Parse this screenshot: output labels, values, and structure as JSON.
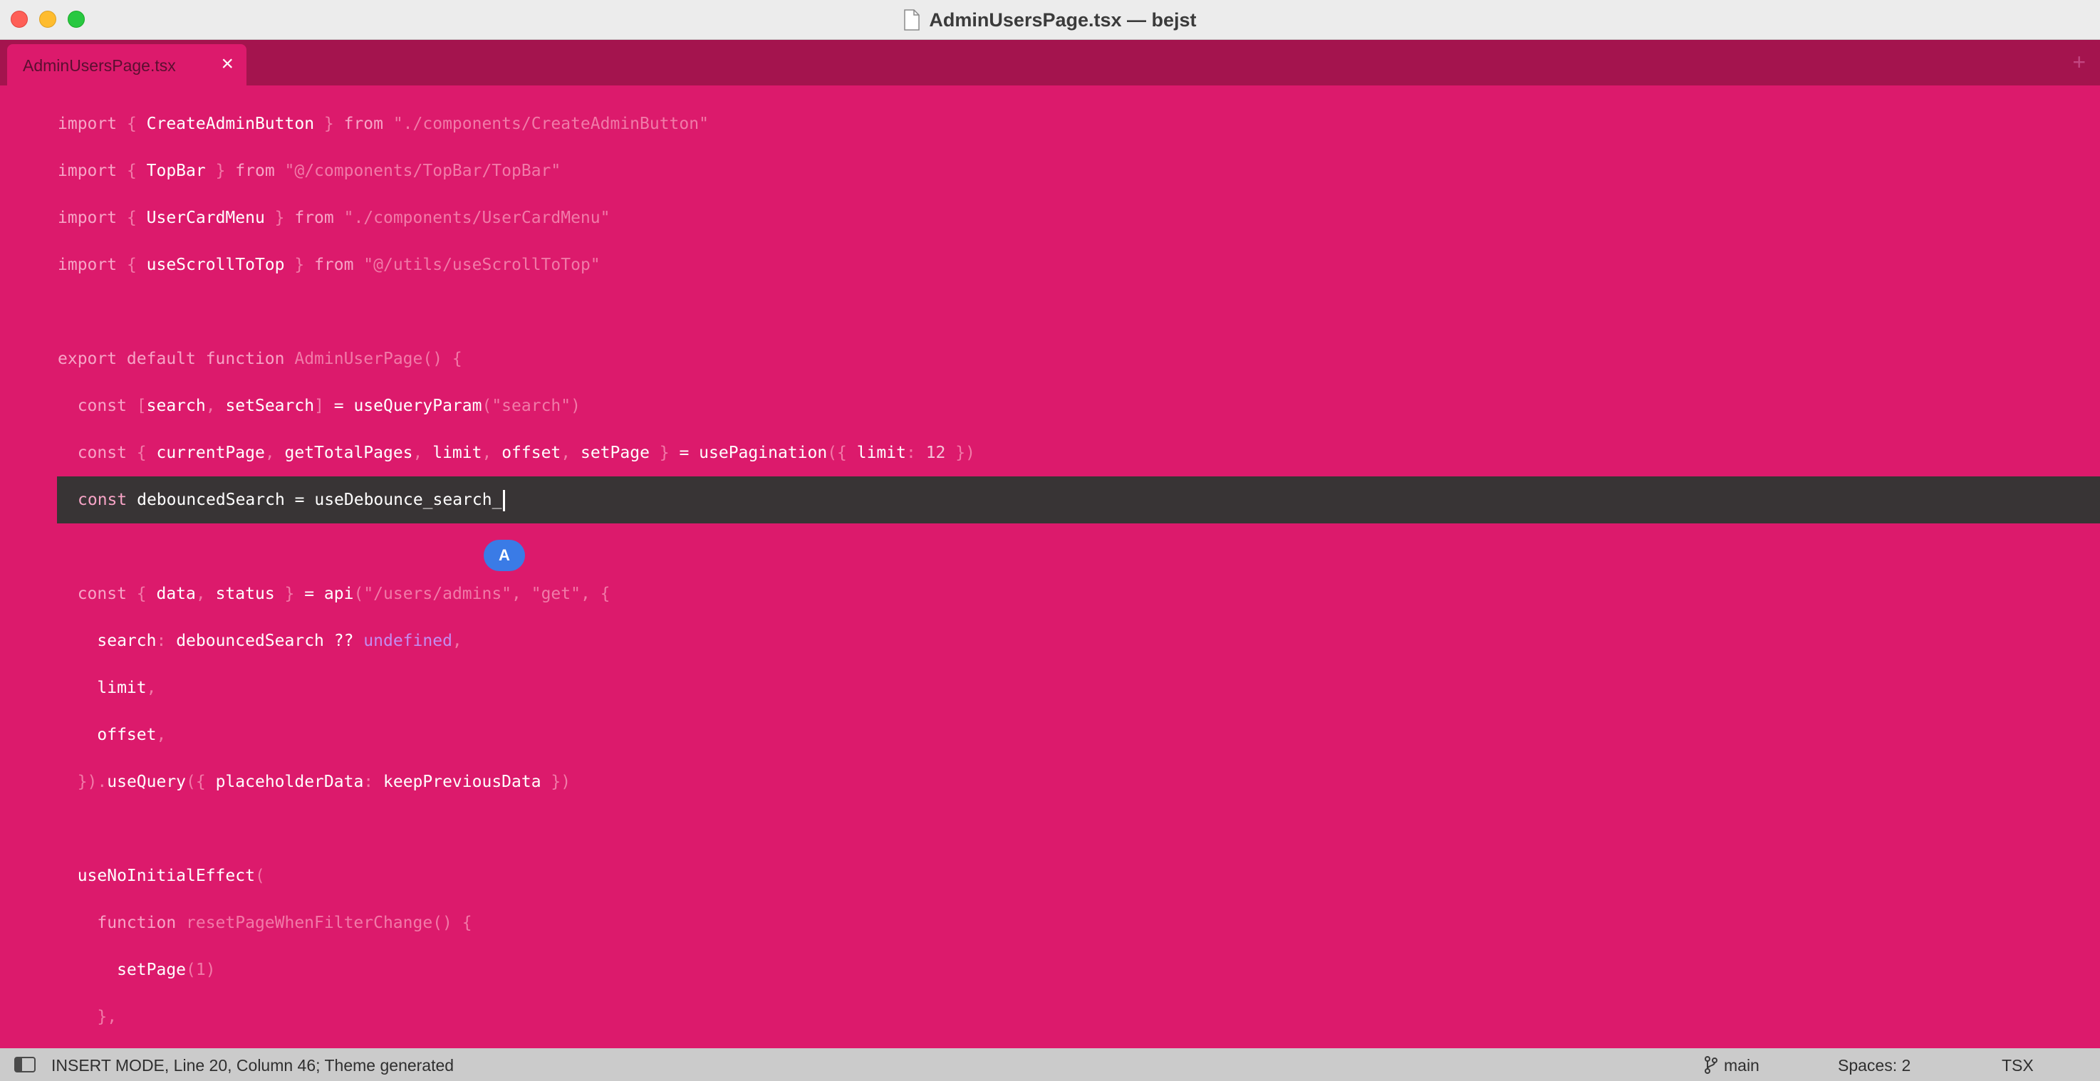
{
  "window": {
    "title": "AdminUsersPage.tsx — bejst"
  },
  "tabs": [
    {
      "label": "AdminUsersPage.tsx",
      "close": "×"
    }
  ],
  "new_tab": "+",
  "editor": {
    "lines": [
      "import { CreateAdminButton } from \"./components/CreateAdminButton\"",
      "import { TopBar } from \"@/components/TopBar/TopBar\"",
      "import { UserCardMenu } from \"./components/UserCardMenu\"",
      "import { useScrollToTop } from \"@/utils/useScrollToTop\"",
      "",
      "export default function AdminUserPage() {",
      "  const [search, setSearch] = useQueryParam(\"search\")",
      "  const { currentPage, getTotalPages, limit, offset, setPage } = usePagination({ limit: 12 })",
      "  const debouncedSearch = useDebounce_search_",
      "",
      "  const { data, status } = api(\"/users/admins\", \"get\", {",
      "    search: debouncedSearch ?? undefined,",
      "    limit,",
      "    offset,",
      "  }).useQuery({ placeholderData: keepPreviousData })",
      "",
      "  useNoInitialEffect(",
      "    function resetPageWhenFilterChange() {",
      "      setPage(1)",
      "    },"
    ],
    "badge": "A",
    "colors": {
      "background": "#dc1a6c",
      "active_line": "#383435",
      "tab_bar": "#a4144e"
    }
  },
  "status": {
    "mode": "INSERT MODE, Line 20, Column 46; Theme generated",
    "branch": "main",
    "spaces": "Spaces: 2",
    "language": "TSX"
  }
}
